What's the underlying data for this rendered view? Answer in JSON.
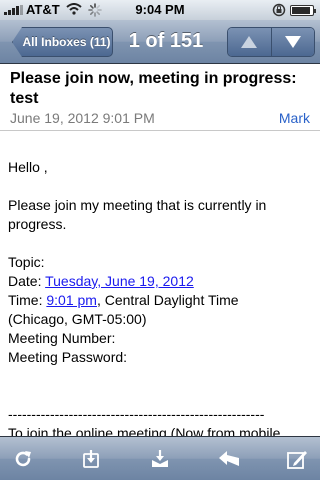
{
  "status_bar": {
    "carrier": "AT&T",
    "time": "9:04 PM",
    "battery_level": 0.9
  },
  "nav": {
    "back_label": "All Inboxes (11)",
    "title": "1 of 151",
    "prev_icon": "arrow-up-icon",
    "next_icon": "arrow-down-icon"
  },
  "message": {
    "subject": "Please join now, meeting in progress: test",
    "date": "June 19, 2012 9:01 PM",
    "details_link": "Mark",
    "body": {
      "greeting": "Hello ,",
      "intro_line1": "Please join my meeting that is currently in",
      "intro_line2": "progress.",
      "topic_label": "Topic:",
      "date_label": "Date: ",
      "date_link": "Tuesday, June 19, 2012",
      "time_label": "Time: ",
      "time_link": "9:01 pm",
      "time_suffix": ", Central Daylight Time",
      "timezone": "(Chicago, GMT-05:00)",
      "meeting_number_label": "Meeting Number:",
      "meeting_password_label": "Meeting Password:",
      "separator": "-------------------------------------------------------",
      "join_line": "To join the online meeting (Now from mobile"
    }
  },
  "toolbar": {
    "icons": [
      "refresh-icon",
      "move-to-folder-icon",
      "archive-icon",
      "reply-icon",
      "compose-icon"
    ]
  },
  "colors": {
    "nav_blue": "#6d84a3",
    "link_blue": "#1a1aee",
    "detail_blue": "#2a62c9"
  }
}
